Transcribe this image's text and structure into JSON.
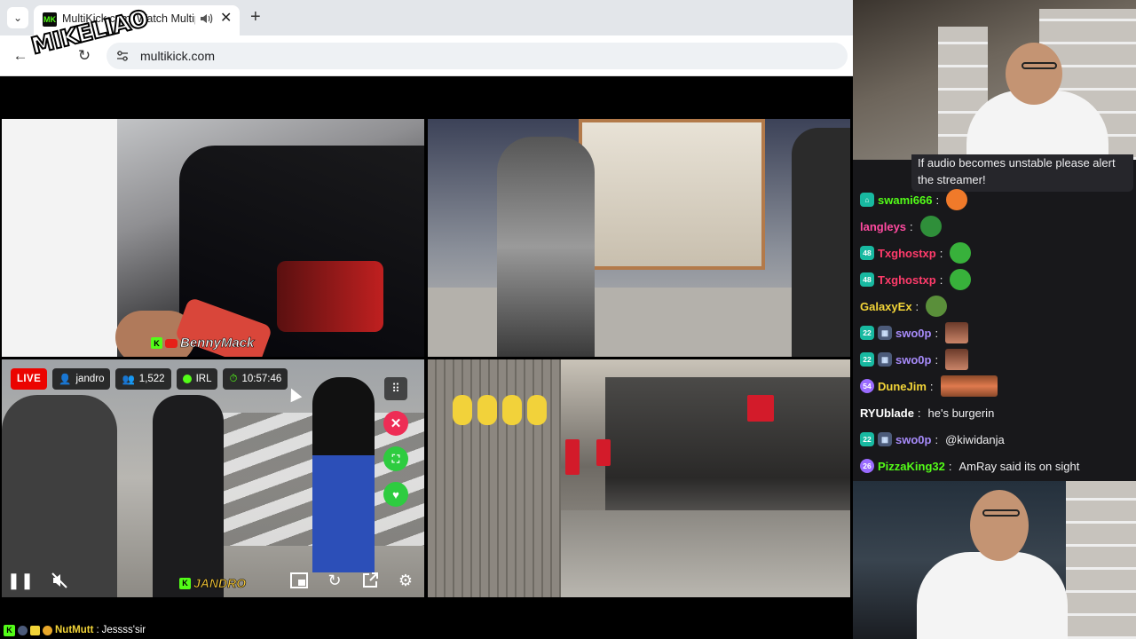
{
  "browser": {
    "tab_title": "MultiKick.com: Watch Multiple Kick Streams",
    "favicon_text": "MK",
    "url": "multikick.com",
    "watermark": "MIKELIAO"
  },
  "streams": {
    "s1": {
      "channel_tag": "BennyMack"
    },
    "s3": {
      "live_label": "LIVE",
      "channel": "jandro",
      "viewers": "1,522",
      "category": "IRL",
      "uptime": "10:57:46",
      "channel_tag": "JANDRO"
    }
  },
  "chat": {
    "alert": "If audio becomes unstable please alert the streamer!",
    "messages": [
      {
        "user": "swami666",
        "color": "#53fc18",
        "badges": [
          "sub"
        ],
        "text": "",
        "emote": "#f07a2a"
      },
      {
        "user": "langleys",
        "color": "#ff4aa0",
        "badges": [],
        "text": "",
        "emote": "#2f8f3a"
      },
      {
        "user": "Txghostxp",
        "color": "#ff3b6b",
        "badges": [
          "48"
        ],
        "text": "",
        "emote": "#38b13b"
      },
      {
        "user": "Txghostxp",
        "color": "#ff3b6b",
        "badges": [
          "48"
        ],
        "text": "",
        "emote": "#38b13b"
      },
      {
        "user": "GalaxyEx",
        "color": "#f2d438",
        "badges": [],
        "text": "",
        "emote": "#5a8f3a"
      },
      {
        "user": "swo0p",
        "color": "#a78bfa",
        "badges": [
          "22",
          "grid"
        ],
        "text": "",
        "emote": "face"
      },
      {
        "user": "swo0p",
        "color": "#a78bfa",
        "badges": [
          "22",
          "grid"
        ],
        "text": "",
        "emote": "face"
      },
      {
        "user": "DuneJim",
        "color": "#f2d438",
        "badges": [
          "54"
        ],
        "text": "",
        "emote": "wide"
      },
      {
        "user": "RYUblade",
        "color": "#ffffff",
        "badges": [],
        "text": "he's burgerin",
        "emote": ""
      },
      {
        "user": "swo0p",
        "color": "#a78bfa",
        "badges": [
          "22",
          "grid"
        ],
        "text": "@kiwidanja",
        "emote": ""
      },
      {
        "user": "PizzaKing32",
        "color": "#53fc18",
        "badges": [
          "26"
        ],
        "text": "AmRay said its on sight",
        "emote": ""
      }
    ]
  },
  "bottom_strip": {
    "user": "NutMutt",
    "user_color": "#f2d438",
    "text": "Jessss'sir"
  },
  "colors": {
    "kick_green": "#53fc18",
    "live_red": "#eb0400"
  }
}
